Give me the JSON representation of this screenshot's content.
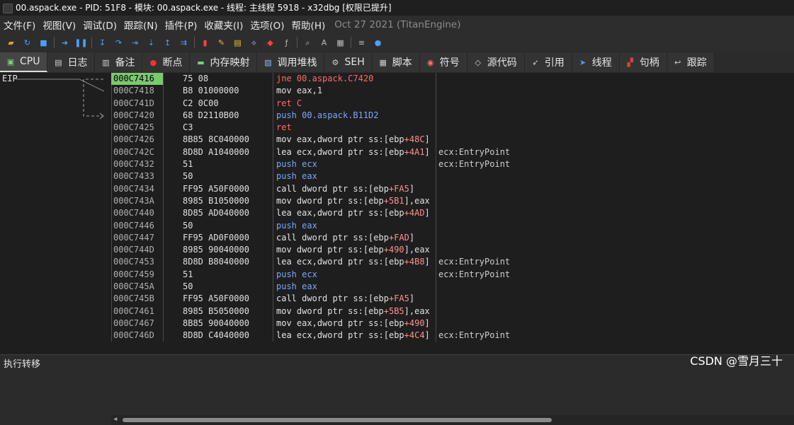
{
  "window": {
    "title": "00.aspack.exe - PID: 51F8 - 模块: 00.aspack.exe - 线程: 主线程 5918 - x32dbg [权限已提升]"
  },
  "menu": {
    "items": [
      "文件(F)",
      "视图(V)",
      "调试(D)",
      "跟踪(N)",
      "插件(P)",
      "收藏夹(I)",
      "选项(O)",
      "帮助(H)"
    ],
    "build_date": "Oct 27 2021 (TitanEngine)"
  },
  "toolbar": {
    "icons": [
      {
        "name": "open-icon",
        "color": "#e0a030"
      },
      {
        "name": "restart-icon",
        "color": "#4aa0ff"
      },
      {
        "name": "stop-icon",
        "color": "#4aa0ff"
      },
      {
        "name": "run-icon",
        "color": "#4aa0ff"
      },
      {
        "name": "pause-icon",
        "color": "#4aa0ff"
      },
      {
        "name": "step-into-icon",
        "color": "#4aa0ff"
      },
      {
        "name": "step-over-icon",
        "color": "#4aa0ff"
      },
      {
        "name": "trace-into-icon",
        "color": "#4aa0ff"
      },
      {
        "name": "trace-over-icon",
        "color": "#4aa0ff"
      },
      {
        "name": "execute-till-return-icon",
        "color": "#4aa0ff"
      },
      {
        "name": "run-to-user-code-icon",
        "color": "#4aa0ff"
      },
      {
        "name": "scylla-icon",
        "color": "#ff4040"
      },
      {
        "name": "patch-icon",
        "color": "#ffb040"
      },
      {
        "name": "comment-icon",
        "color": "#f0c030"
      },
      {
        "name": "label-icon",
        "color": "#a0a0ff"
      },
      {
        "name": "bookmark-icon",
        "color": "#ff4040"
      },
      {
        "name": "function-icon",
        "color": "#bbbbbb"
      },
      {
        "name": "find-icon",
        "color": "#bbbbbb"
      },
      {
        "name": "strings-icon",
        "color": "#bbbbbb"
      },
      {
        "name": "calculator-icon",
        "color": "#bbbbbb"
      },
      {
        "name": "memory-icon",
        "color": "#bbbbbb"
      },
      {
        "name": "help-icon",
        "color": "#4aa0ff"
      }
    ]
  },
  "tabs": [
    {
      "label": "CPU",
      "icon": "cpu-icon",
      "active": true
    },
    {
      "label": "日志",
      "icon": "log-icon"
    },
    {
      "label": "备注",
      "icon": "notes-icon"
    },
    {
      "label": "断点",
      "icon": "breakpoint-icon"
    },
    {
      "label": "内存映射",
      "icon": "memory-map-icon"
    },
    {
      "label": "调用堆栈",
      "icon": "call-stack-icon"
    },
    {
      "label": "SEH",
      "icon": "seh-icon"
    },
    {
      "label": "脚本",
      "icon": "script-icon"
    },
    {
      "label": "符号",
      "icon": "symbols-icon"
    },
    {
      "label": "源代码",
      "icon": "source-icon"
    },
    {
      "label": "引用",
      "icon": "references-icon"
    },
    {
      "label": "线程",
      "icon": "threads-icon"
    },
    {
      "label": "句柄",
      "icon": "handles-icon"
    },
    {
      "label": "跟踪",
      "icon": "trace-icon"
    }
  ],
  "disassembly": {
    "eip_label": "EIP",
    "rows": [
      {
        "addr": "000C7416",
        "bytes": "75 08",
        "mnemonic": "jne",
        "operands": "00.aspack.C7420",
        "comment": "",
        "current": true
      },
      {
        "addr": "000C7418",
        "bytes": "B8 01000000",
        "mnemonic": "mov",
        "operands": "eax,1",
        "comment": ""
      },
      {
        "addr": "000C741D",
        "bytes": "C2 0C00",
        "mnemonic": "ret",
        "operands": "C",
        "comment": ""
      },
      {
        "addr": "000C7420",
        "bytes": "68 D2110B00",
        "mnemonic": "push",
        "operands": "00.aspack.B11D2",
        "comment": ""
      },
      {
        "addr": "000C7425",
        "bytes": "C3",
        "mnemonic": "ret",
        "operands": "",
        "comment": ""
      },
      {
        "addr": "000C7426",
        "bytes": "8B85 8C040000",
        "mnemonic": "mov",
        "operands": "eax,dword ptr ss:[ebp+48C]",
        "comment": ""
      },
      {
        "addr": "000C742C",
        "bytes": "8D8D A1040000",
        "mnemonic": "lea",
        "operands": "ecx,dword ptr ss:[ebp+4A1]",
        "comment": "ecx:EntryPoint"
      },
      {
        "addr": "000C7432",
        "bytes": "51",
        "mnemonic": "push",
        "operands": "ecx",
        "comment": "ecx:EntryPoint"
      },
      {
        "addr": "000C7433",
        "bytes": "50",
        "mnemonic": "push",
        "operands": "eax",
        "comment": ""
      },
      {
        "addr": "000C7434",
        "bytes": "FF95 A50F0000",
        "mnemonic": "call",
        "operands": "dword ptr ss:[ebp+FA5]",
        "comment": ""
      },
      {
        "addr": "000C743A",
        "bytes": "8985 B1050000",
        "mnemonic": "mov",
        "operands": "dword ptr ss:[ebp+5B1],eax",
        "comment": ""
      },
      {
        "addr": "000C7440",
        "bytes": "8D85 AD040000",
        "mnemonic": "lea",
        "operands": "eax,dword ptr ss:[ebp+4AD]",
        "comment": ""
      },
      {
        "addr": "000C7446",
        "bytes": "50",
        "mnemonic": "push",
        "operands": "eax",
        "comment": ""
      },
      {
        "addr": "000C7447",
        "bytes": "FF95 AD0F0000",
        "mnemonic": "call",
        "operands": "dword ptr ss:[ebp+FAD]",
        "comment": ""
      },
      {
        "addr": "000C744D",
        "bytes": "8985 90040000",
        "mnemonic": "mov",
        "operands": "dword ptr ss:[ebp+490],eax",
        "comment": ""
      },
      {
        "addr": "000C7453",
        "bytes": "8D8D B8040000",
        "mnemonic": "lea",
        "operands": "ecx,dword ptr ss:[ebp+4B8]",
        "comment": "ecx:EntryPoint"
      },
      {
        "addr": "000C7459",
        "bytes": "51",
        "mnemonic": "push",
        "operands": "ecx",
        "comment": "ecx:EntryPoint"
      },
      {
        "addr": "000C745A",
        "bytes": "50",
        "mnemonic": "push",
        "operands": "eax",
        "comment": ""
      },
      {
        "addr": "000C745B",
        "bytes": "FF95 A50F0000",
        "mnemonic": "call",
        "operands": "dword ptr ss:[ebp+FA5]",
        "comment": ""
      },
      {
        "addr": "000C7461",
        "bytes": "8985 B5050000",
        "mnemonic": "mov",
        "operands": "dword ptr ss:[ebp+5B5],eax",
        "comment": ""
      },
      {
        "addr": "000C7467",
        "bytes": "8B85 90040000",
        "mnemonic": "mov",
        "operands": "eax,dword ptr ss:[ebp+490]",
        "comment": ""
      },
      {
        "addr": "000C746D",
        "bytes": "8D8D C4040000",
        "mnemonic": "lea",
        "operands": "ecx,dword ptr ss:[ebp+4C4]",
        "comment": "ecx:EntryPoint"
      }
    ]
  },
  "status": {
    "text": "执行转移",
    "watermark": "CSDN @雪月三十"
  },
  "colors": {
    "current_addr_bg": "#7bc86e",
    "jump": "#ff6a6a",
    "push": "#7aa7ff"
  }
}
